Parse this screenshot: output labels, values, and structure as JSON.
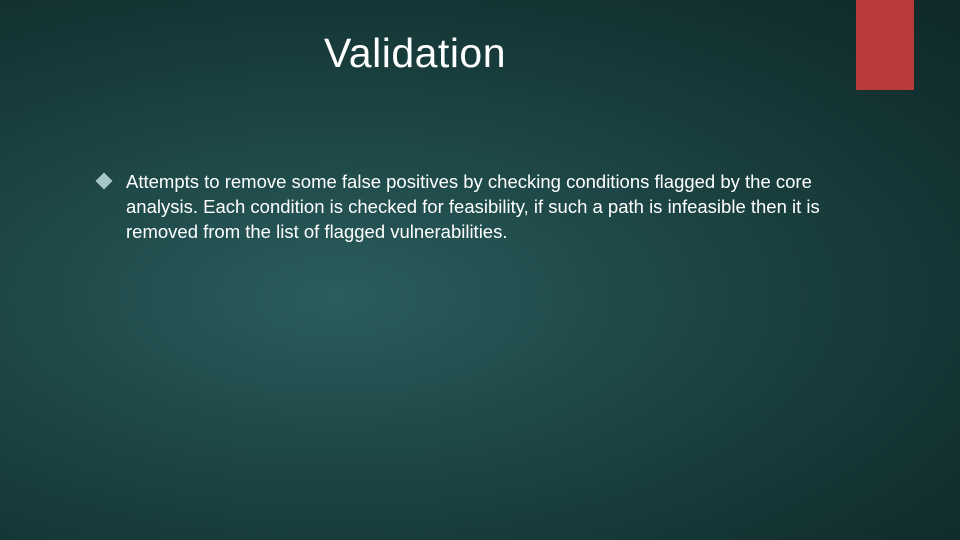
{
  "slide": {
    "title": "Validation",
    "bullets": [
      {
        "text": "Attempts to remove some false positives by checking conditions flagged by the core analysis. Each condition is checked for feasibility, if such a path is infeasible then it is removed from the list of flagged vulnerabilities."
      }
    ]
  },
  "theme": {
    "accent_color": "#b83a3a",
    "background_gradient": [
      "#2a5d5d",
      "#163838",
      "#0f2828"
    ],
    "text_color": "#ffffff",
    "bullet_icon_color": "#a8c8c8"
  }
}
